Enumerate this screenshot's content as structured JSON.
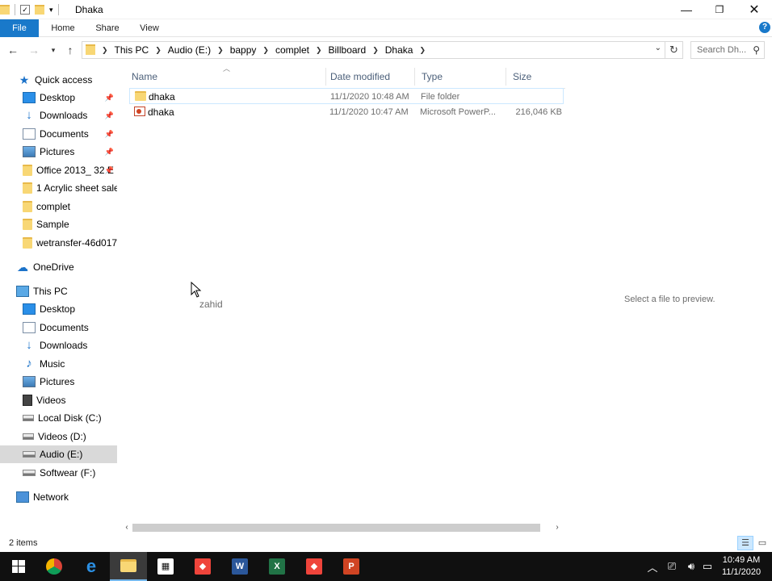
{
  "window": {
    "title": "Dhaka"
  },
  "ribbon": {
    "tabs": [
      "File",
      "Home",
      "Share",
      "View"
    ],
    "help": "?"
  },
  "address": {
    "crumbs": [
      "This PC",
      "Audio (E:)",
      "bappy",
      "complet",
      "Billboard",
      "Dhaka"
    ],
    "search_placeholder": "Search Dh..."
  },
  "sidebar": {
    "quick_access": "Quick access",
    "quick_items": [
      {
        "label": "Desktop",
        "icon": "desktop-icon",
        "pinned": true
      },
      {
        "label": "Downloads",
        "icon": "downloads-icon",
        "pinned": true
      },
      {
        "label": "Documents",
        "icon": "documents-icon",
        "pinned": true
      },
      {
        "label": "Pictures",
        "icon": "pictures-icon",
        "pinned": true
      },
      {
        "label": "Office 2013_ 32 E",
        "icon": "folder-icon",
        "pinned": true
      },
      {
        "label": "1 Acrylic sheet sale",
        "icon": "folder-icon",
        "pinned": false
      },
      {
        "label": "complet",
        "icon": "folder-icon",
        "pinned": false
      },
      {
        "label": "Sample",
        "icon": "folder-icon",
        "pinned": false
      },
      {
        "label": "wetransfer-46d017",
        "icon": "folder-icon",
        "pinned": false
      }
    ],
    "onedrive": "OneDrive",
    "this_pc": "This PC",
    "pc_items": [
      {
        "label": "Desktop",
        "icon": "desktop-icon"
      },
      {
        "label": "Documents",
        "icon": "documents-icon"
      },
      {
        "label": "Downloads",
        "icon": "downloads-icon"
      },
      {
        "label": "Music",
        "icon": "music-icon"
      },
      {
        "label": "Pictures",
        "icon": "pictures-icon"
      },
      {
        "label": "Videos",
        "icon": "videos-icon"
      },
      {
        "label": "Local Disk (C:)",
        "icon": "drive-icon"
      },
      {
        "label": "Videos (D:)",
        "icon": "drive-icon"
      },
      {
        "label": "Audio (E:)",
        "icon": "drive-icon",
        "selected": true
      },
      {
        "label": "Softwear (F:)",
        "icon": "drive-icon"
      }
    ],
    "network": "Network"
  },
  "columns": {
    "name": "Name",
    "date": "Date modified",
    "type": "Type",
    "size": "Size"
  },
  "files": [
    {
      "name": "dhaka",
      "date": "11/1/2020 10:48 AM",
      "type": "File folder",
      "size": "",
      "icon": "folder-icon"
    },
    {
      "name": "dhaka",
      "date": "11/1/2020 10:47 AM",
      "type": "Microsoft PowerP...",
      "size": "216,046 KB",
      "icon": "powerpoint-file-icon"
    }
  ],
  "preview_text": "Select a file to preview.",
  "cursor_label": "zahid",
  "status": {
    "count": "2 items"
  },
  "taskbar": {
    "clock_time": "10:49 AM",
    "clock_date": "11/1/2020",
    "apps": [
      "start",
      "chrome",
      "edge",
      "file-explorer",
      "store",
      "anydesk",
      "word",
      "excel",
      "anydesk",
      "powerpoint"
    ]
  },
  "colors": {
    "accent": "#1979ca",
    "selection": "#cce8ff",
    "taskbar": "#101010"
  }
}
